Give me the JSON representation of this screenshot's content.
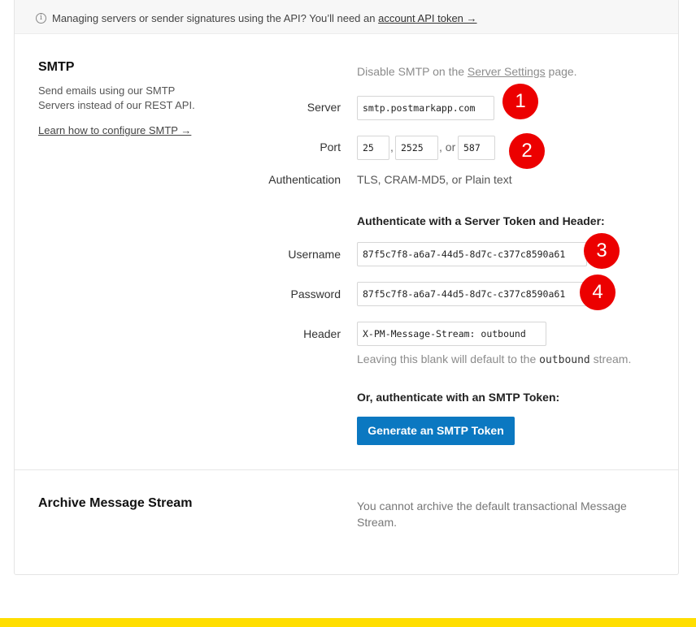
{
  "notice": {
    "icon": "info-icon",
    "text": "Managing servers or sender signatures using the API? You’ll need an ",
    "link": "account API token →"
  },
  "smtp": {
    "title": "SMTP",
    "description_line1": "Send emails using our SMTP",
    "description_line2": "Servers instead of our REST API.",
    "learn_link": "Learn how to configure SMTP →",
    "disable_prefix": "Disable SMTP on the ",
    "disable_link": "Server Settings",
    "disable_suffix": " page.",
    "server_label": "Server",
    "server_value": "smtp.postmarkapp.com",
    "port_label": "Port",
    "ports": [
      "25",
      "2525",
      "587"
    ],
    "port_sep1": ",",
    "port_sep2": ", or",
    "auth_label": "Authentication",
    "auth_value": "TLS, CRAM-MD5, or Plain text",
    "server_token_heading": "Authenticate with a Server Token and Header:",
    "username_label": "Username",
    "username_value": "87f5c7f8-a6a7-44d5-8d7c-c377c8590a61",
    "password_label": "Password",
    "password_value": "87f5c7f8-a6a7-44d5-8d7c-c377c8590a61",
    "header_label": "Header",
    "header_value": "X-PM-Message-Stream: outbound",
    "header_hint_prefix": "Leaving this blank will default to the ",
    "header_hint_code": "outbound",
    "header_hint_suffix": " stream.",
    "smtp_token_heading": "Or, authenticate with an SMTP Token:",
    "generate_button": "Generate an SMTP Token"
  },
  "archive": {
    "title": "Archive Message Stream",
    "text_line1": "You cannot archive the default transactional Message",
    "text_line2": "Stream."
  },
  "badges": [
    "1",
    "2",
    "3",
    "4"
  ],
  "colors": {
    "button": "#0b78c1",
    "badge": "#ec0000",
    "footer_bar": "#ffde00"
  }
}
